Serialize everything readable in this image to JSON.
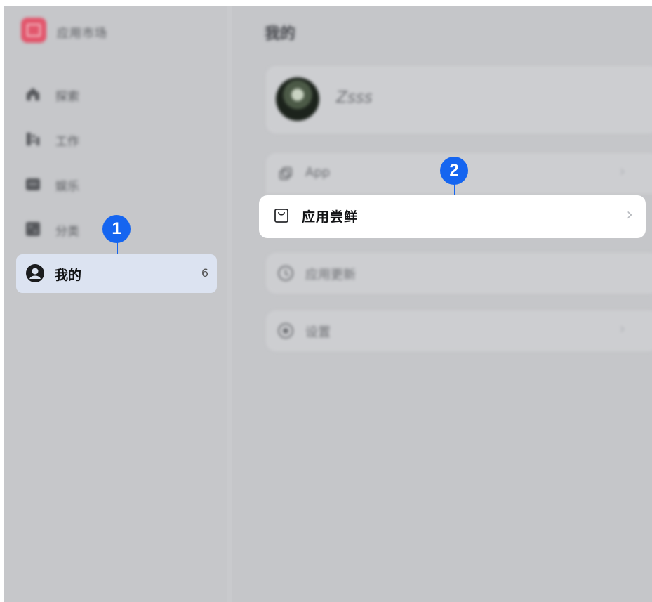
{
  "sidebar": {
    "app_name": "应用市场",
    "items": [
      {
        "label": "探索",
        "icon": "home-icon"
      },
      {
        "label": "工作",
        "icon": "work-icon"
      },
      {
        "label": "娱乐",
        "icon": "game-icon"
      },
      {
        "label": "分类",
        "icon": "category-icon"
      }
    ],
    "active_item": {
      "label": "我的",
      "badge": "6",
      "icon": "user-icon"
    }
  },
  "main": {
    "title": "我的",
    "profile": {
      "username": "Zsss"
    },
    "rows": [
      {
        "label": "App",
        "icon": "app-icon"
      },
      {
        "label": "应用尝鲜",
        "icon": "bag-icon",
        "highlighted": true
      },
      {
        "label": "应用更新",
        "icon": "update-icon"
      },
      {
        "label": "设置",
        "icon": "settings-icon"
      }
    ]
  },
  "markers": {
    "first": "1",
    "second": "2"
  },
  "colors": {
    "accent": "#1565f0",
    "active_bg": "#dce3f1",
    "logo": "#e2566c"
  }
}
